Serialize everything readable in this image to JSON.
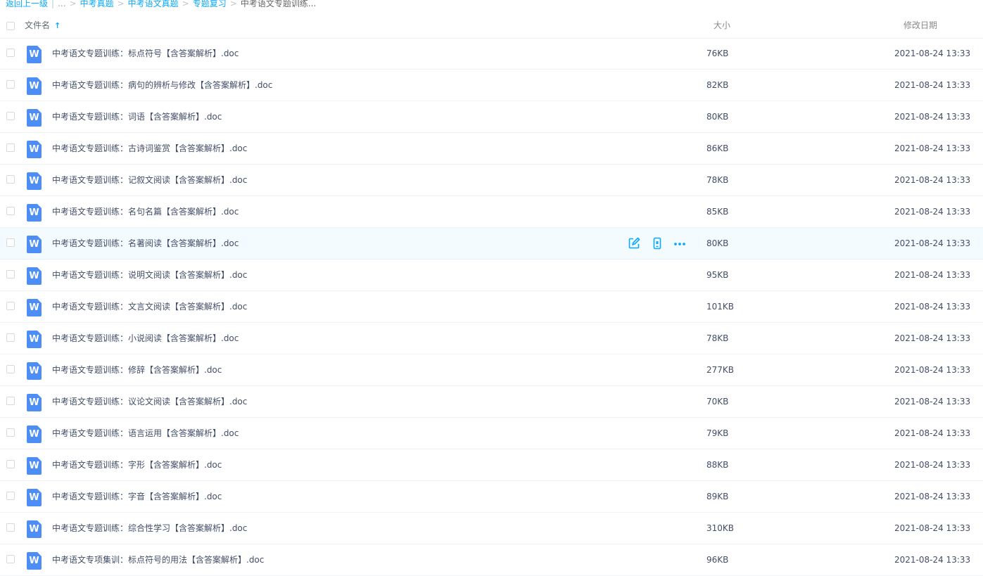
{
  "breadcrumb": {
    "back": "返回上一级",
    "ellipsis": "...",
    "items": [
      "中考真题",
      "中考语文真题",
      "专题复习"
    ],
    "current": "中考语文专题训练..."
  },
  "header": {
    "name": "文件名",
    "sort_icon": "arrow-up-icon",
    "size": "大小",
    "date": "修改日期"
  },
  "file_icon_letter": "W",
  "accent_color": "#09aaff",
  "files": [
    {
      "name": "中考语文专题训练：标点符号【含答案解析】.doc",
      "size": "76KB",
      "date": "2021-08-24 13:33"
    },
    {
      "name": "中考语文专题训练：病句的辨析与修改【含答案解析】.doc",
      "size": "82KB",
      "date": "2021-08-24 13:33"
    },
    {
      "name": "中考语文专题训练：词语【含答案解析】.doc",
      "size": "80KB",
      "date": "2021-08-24 13:33"
    },
    {
      "name": "中考语文专题训练：古诗词鉴赏【含答案解析】.doc",
      "size": "86KB",
      "date": "2021-08-24 13:33"
    },
    {
      "name": "中考语文专题训练：记叙文阅读【含答案解析】.doc",
      "size": "78KB",
      "date": "2021-08-24 13:33"
    },
    {
      "name": "中考语文专题训练：名句名篇【含答案解析】.doc",
      "size": "85KB",
      "date": "2021-08-24 13:33"
    },
    {
      "name": "中考语文专题训练：名著阅读【含答案解析】.doc",
      "size": "80KB",
      "date": "2021-08-24 13:33",
      "hover": true
    },
    {
      "name": "中考语文专题训练：说明文阅读【含答案解析】.doc",
      "size": "95KB",
      "date": "2021-08-24 13:33"
    },
    {
      "name": "中考语文专题训练：文言文阅读【含答案解析】.doc",
      "size": "101KB",
      "date": "2021-08-24 13:33"
    },
    {
      "name": "中考语文专题训练：小说阅读【含答案解析】.doc",
      "size": "78KB",
      "date": "2021-08-24 13:33"
    },
    {
      "name": "中考语文专题训练：修辞【含答案解析】.doc",
      "size": "277KB",
      "date": "2021-08-24 13:33"
    },
    {
      "name": "中考语文专题训练：议论文阅读【含答案解析】.doc",
      "size": "70KB",
      "date": "2021-08-24 13:33"
    },
    {
      "name": "中考语文专题训练：语言运用【含答案解析】.doc",
      "size": "79KB",
      "date": "2021-08-24 13:33"
    },
    {
      "name": "中考语文专题训练：字形【含答案解析】.doc",
      "size": "88KB",
      "date": "2021-08-24 13:33"
    },
    {
      "name": "中考语文专题训练：字音【含答案解析】.doc",
      "size": "89KB",
      "date": "2021-08-24 13:33"
    },
    {
      "name": "中考语文专题训练：综合性学习【含答案解析】.doc",
      "size": "310KB",
      "date": "2021-08-24 13:33"
    },
    {
      "name": "中考语文专项集训：标点符号的用法【含答案解析】.doc",
      "size": "96KB",
      "date": "2021-08-24 13:33"
    }
  ],
  "row_actions": [
    "edit-icon",
    "phone-icon",
    "more-icon"
  ]
}
